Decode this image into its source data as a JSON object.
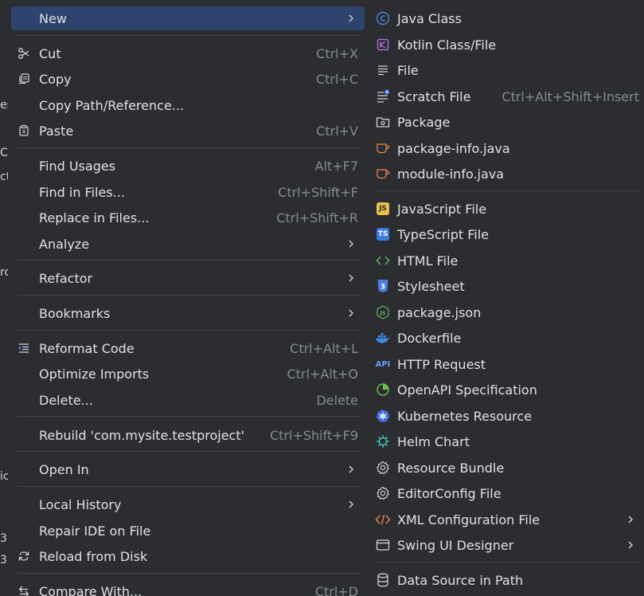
{
  "background": {
    "fragments": [
      "es",
      "Co",
      "ct",
      "ro",
      "ic",
      "3",
      "3"
    ]
  },
  "main_menu": {
    "items": [
      {
        "label": "New",
        "shortcut": "",
        "submenu": true,
        "icon": ""
      },
      {
        "label": "Cut",
        "shortcut": "Ctrl+X",
        "submenu": false,
        "icon": "scissors-icon"
      },
      {
        "label": "Copy",
        "shortcut": "Ctrl+C",
        "submenu": false,
        "icon": "copy-icon"
      },
      {
        "label": "Copy Path/Reference...",
        "shortcut": "",
        "submenu": false,
        "icon": ""
      },
      {
        "label": "Paste",
        "shortcut": "Ctrl+V",
        "submenu": false,
        "icon": "paste-icon"
      },
      {
        "label": "Find Usages",
        "shortcut": "Alt+F7",
        "submenu": false,
        "icon": ""
      },
      {
        "label": "Find in Files...",
        "shortcut": "Ctrl+Shift+F",
        "submenu": false,
        "icon": ""
      },
      {
        "label": "Replace in Files...",
        "shortcut": "Ctrl+Shift+R",
        "submenu": false,
        "icon": ""
      },
      {
        "label": "Analyze",
        "shortcut": "",
        "submenu": true,
        "icon": ""
      },
      {
        "label": "Refactor",
        "shortcut": "",
        "submenu": true,
        "icon": ""
      },
      {
        "label": "Bookmarks",
        "shortcut": "",
        "submenu": true,
        "icon": ""
      },
      {
        "label": "Reformat Code",
        "shortcut": "Ctrl+Alt+L",
        "submenu": false,
        "icon": "reformat-icon"
      },
      {
        "label": "Optimize Imports",
        "shortcut": "Ctrl+Alt+O",
        "submenu": false,
        "icon": ""
      },
      {
        "label": "Delete...",
        "shortcut": "Delete",
        "submenu": false,
        "icon": ""
      },
      {
        "label": "Rebuild 'com.mysite.testproject'",
        "shortcut": "Ctrl+Shift+F9",
        "submenu": false,
        "icon": ""
      },
      {
        "label": "Open In",
        "shortcut": "",
        "submenu": true,
        "icon": ""
      },
      {
        "label": "Local History",
        "shortcut": "",
        "submenu": true,
        "icon": ""
      },
      {
        "label": "Repair IDE on File",
        "shortcut": "",
        "submenu": false,
        "icon": ""
      },
      {
        "label": "Reload from Disk",
        "shortcut": "",
        "submenu": false,
        "icon": "reload-icon"
      },
      {
        "label": "Compare With...",
        "shortcut": "Ctrl+D",
        "submenu": false,
        "icon": "compare-icon"
      }
    ]
  },
  "sub_menu": {
    "items": [
      {
        "label": "Java Class",
        "shortcut": "",
        "submenu": false,
        "icon": "java-class-icon"
      },
      {
        "label": "Kotlin Class/File",
        "shortcut": "",
        "submenu": false,
        "icon": "kotlin-icon"
      },
      {
        "label": "File",
        "shortcut": "",
        "submenu": false,
        "icon": "file-icon"
      },
      {
        "label": "Scratch File",
        "shortcut": "Ctrl+Alt+Shift+Insert",
        "submenu": false,
        "icon": "scratch-file-icon"
      },
      {
        "label": "Package",
        "shortcut": "",
        "submenu": false,
        "icon": "package-icon"
      },
      {
        "label": "package-info.java",
        "shortcut": "",
        "submenu": false,
        "icon": "java-cup-icon"
      },
      {
        "label": "module-info.java",
        "shortcut": "",
        "submenu": false,
        "icon": "java-cup-icon"
      },
      {
        "label": "JavaScript File",
        "shortcut": "",
        "submenu": false,
        "icon": "javascript-icon",
        "badge": "JS"
      },
      {
        "label": "TypeScript File",
        "shortcut": "",
        "submenu": false,
        "icon": "typescript-icon",
        "badge": "TS"
      },
      {
        "label": "HTML File",
        "shortcut": "",
        "submenu": false,
        "icon": "html-icon"
      },
      {
        "label": "Stylesheet",
        "shortcut": "",
        "submenu": false,
        "icon": "css-icon",
        "badge": "3"
      },
      {
        "label": "package.json",
        "shortcut": "",
        "submenu": false,
        "icon": "nodejs-icon",
        "badge": "JS"
      },
      {
        "label": "Dockerfile",
        "shortcut": "",
        "submenu": false,
        "icon": "docker-icon"
      },
      {
        "label": "HTTP Request",
        "shortcut": "",
        "submenu": false,
        "icon": "api-icon",
        "badge": "API"
      },
      {
        "label": "OpenAPI Specification",
        "shortcut": "",
        "submenu": false,
        "icon": "openapi-icon"
      },
      {
        "label": "Kubernetes Resource",
        "shortcut": "",
        "submenu": false,
        "icon": "kubernetes-icon"
      },
      {
        "label": "Helm Chart",
        "shortcut": "",
        "submenu": false,
        "icon": "helm-icon"
      },
      {
        "label": "Resource Bundle",
        "shortcut": "",
        "submenu": false,
        "icon": "gear-icon"
      },
      {
        "label": "EditorConfig File",
        "shortcut": "",
        "submenu": false,
        "icon": "gear-icon"
      },
      {
        "label": "XML Configuration File",
        "shortcut": "",
        "submenu": true,
        "icon": "xml-icon"
      },
      {
        "label": "Swing UI Designer",
        "shortcut": "",
        "submenu": true,
        "icon": "window-icon"
      },
      {
        "label": "Data Source in Path",
        "shortcut": "",
        "submenu": false,
        "icon": "database-icon"
      }
    ]
  },
  "colors": {
    "menu_bg": "#2b2d30",
    "selected_bg": "#2e436e",
    "separator": "#43454a",
    "text": "#dfe1e5",
    "shortcut": "#868a91"
  }
}
